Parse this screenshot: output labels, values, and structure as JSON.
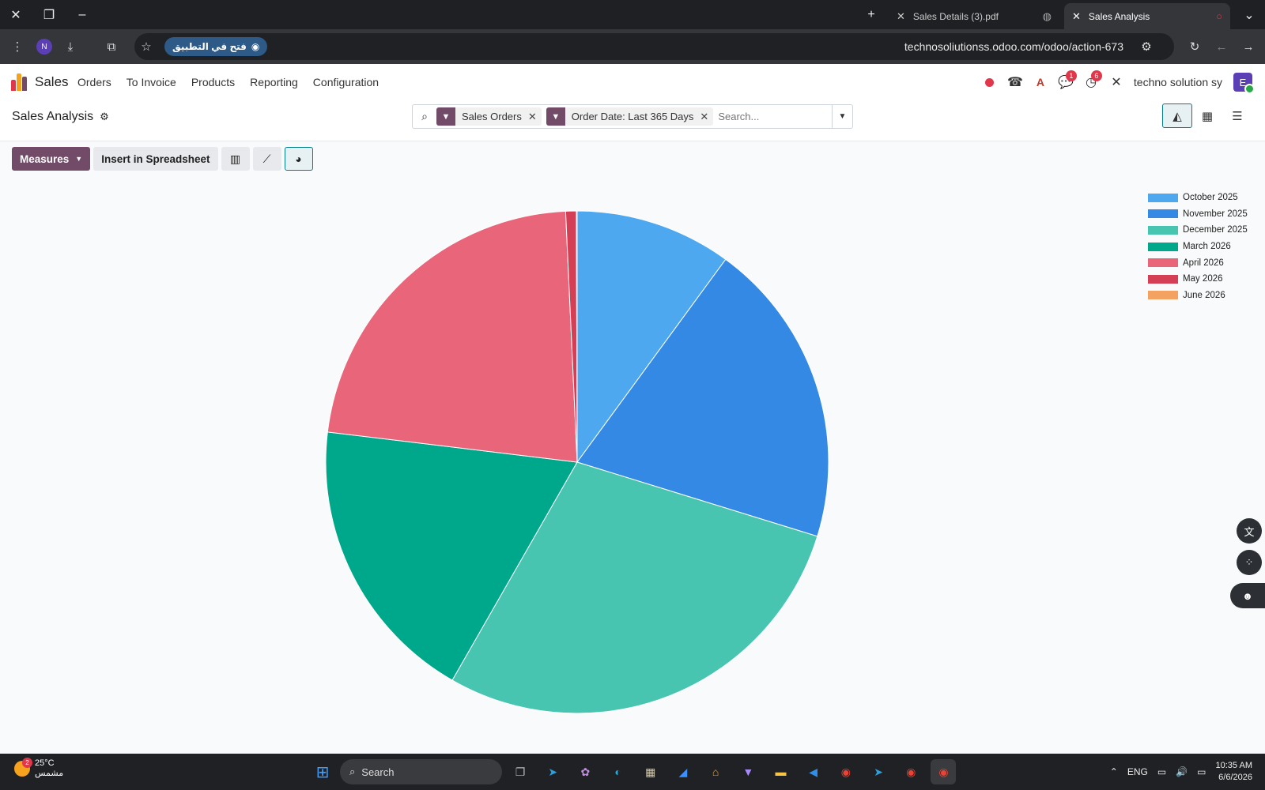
{
  "browser": {
    "tabs": [
      {
        "title": "Sales Details (3).pdf"
      },
      {
        "title": "Sales Analysis"
      }
    ],
    "open_app_label": "فتح في التطبيق",
    "profile_initial": "N",
    "url": "technosoliutionss.odoo.com/odoo/action-673"
  },
  "navbar": {
    "app_name": "Sales",
    "menu": [
      "Orders",
      "To Invoice",
      "Products",
      "Reporting",
      "Configuration"
    ],
    "messages_badge": "1",
    "activities_badge": "6",
    "company": "techno solution sy",
    "user_initial": "E"
  },
  "control_panel": {
    "title": "Sales Analysis",
    "facets": [
      "Sales Orders",
      "Order Date: Last 365 Days"
    ],
    "search_placeholder": "Search..."
  },
  "toolbar": {
    "measures_label": "Measures",
    "insert_label": "Insert in Spreadsheet"
  },
  "chart_data": {
    "type": "pie",
    "categories": [
      "October 2025",
      "November 2025",
      "December 2025",
      "March 2026",
      "April 2026",
      "May 2026",
      "June 2026"
    ],
    "values": [
      10.3,
      20.2,
      29.2,
      19.1,
      22.9,
      0.7,
      0.05
    ],
    "colors": [
      "#4ea8f0",
      "#3389e3",
      "#48c5b1",
      "#00a88b",
      "#e9657a",
      "#d43f55",
      "#f4a261"
    ],
    "legend_position": "top-right"
  },
  "taskbar": {
    "weather_temp": "25°C",
    "weather_desc": "مشمس",
    "weather_badge": "2",
    "search_label": "Search",
    "lang": "ENG",
    "time": "10:35 AM",
    "date": "6/6/2026"
  }
}
